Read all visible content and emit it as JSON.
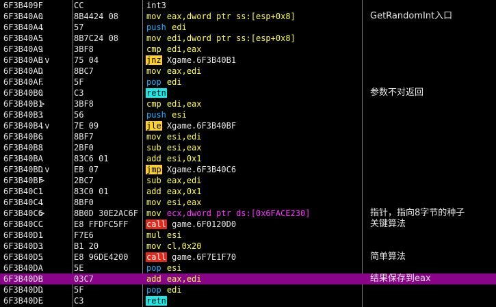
{
  "rows": [
    {
      "addr": "6F3B409F",
      "mark": "",
      "hex": "CC",
      "mn": "int3",
      "mk": "white",
      "ops": "",
      "ok": "plain",
      "cmt": ""
    },
    {
      "addr": "6F3B40A0",
      "mark": ".",
      "hex": "8B4424 08",
      "mn": "mov",
      "mk": "yellow",
      "ops": "eax,dword ptr ss:[esp+0x8]",
      "ok": "yellow",
      "cmt": "GetRandomInt入口"
    },
    {
      "addr": "6F3B40A4",
      "mark": ".",
      "hex": "57",
      "mn": "push",
      "mk": "blue",
      "ops": "edi",
      "ok": "yellow",
      "cmt": ""
    },
    {
      "addr": "6F3B40A5",
      "mark": ".",
      "hex": "8B7C24 08",
      "mn": "mov",
      "mk": "yellow",
      "ops": "edi,dword ptr ss:[esp+0x8]",
      "ok": "yellow",
      "cmt": ""
    },
    {
      "addr": "6F3B40A9",
      "mark": ".",
      "hex": "3BF8",
      "mn": "cmp",
      "mk": "yellow",
      "ops": "edi,eax",
      "ok": "yellow",
      "cmt": ""
    },
    {
      "addr": "6F3B40AB",
      "mark": ".v",
      "hex": "75 04",
      "mn": "jnz",
      "mk": "orange",
      "ops": "Xgame.6F3B40B1",
      "ok": "plain",
      "cmt": ""
    },
    {
      "addr": "6F3B40AD",
      "mark": ".",
      "hex": "8BC7",
      "mn": "mov",
      "mk": "yellow",
      "ops": "eax,edi",
      "ok": "yellow",
      "cmt": ""
    },
    {
      "addr": "6F3B40AF",
      "mark": ".",
      "hex": "5F",
      "mn": "pop",
      "mk": "blue",
      "ops": "edi",
      "ok": "yellow",
      "cmt": ""
    },
    {
      "addr": "6F3B40B0",
      "mark": ".",
      "hex": "C3",
      "mn": "retn",
      "mk": "green",
      "ops": "",
      "ok": "plain",
      "cmt": "参数不对返回"
    },
    {
      "addr": "6F3B40B1",
      "mark": ">",
      "hex": "3BF8",
      "mn": "cmp",
      "mk": "yellow",
      "ops": "edi,eax",
      "ok": "yellow",
      "cmt": ""
    },
    {
      "addr": "6F3B40B3",
      "mark": ".",
      "hex": "56",
      "mn": "push",
      "mk": "blue",
      "ops": "esi",
      "ok": "yellow",
      "cmt": ""
    },
    {
      "addr": "6F3B40B4",
      "mark": ".v",
      "hex": "7E 09",
      "mn": "jle",
      "mk": "orange",
      "ops": "Xgame.6F3B40BF",
      "ok": "plain",
      "cmt": ""
    },
    {
      "addr": "6F3B40B6",
      "mark": ".",
      "hex": "8BF7",
      "mn": "mov",
      "mk": "yellow",
      "ops": "esi,edi",
      "ok": "yellow",
      "cmt": ""
    },
    {
      "addr": "6F3B40B8",
      "mark": ".",
      "hex": "2BF0",
      "mn": "sub",
      "mk": "yellow",
      "ops": "esi,eax",
      "ok": "yellow",
      "cmt": ""
    },
    {
      "addr": "6F3B40BA",
      "mark": ".",
      "hex": "83C6 01",
      "mn": "add",
      "mk": "yellow",
      "ops": "esi,0x1",
      "ok": "yellow",
      "cmt": ""
    },
    {
      "addr": "6F3B40BD",
      "mark": ".v",
      "hex": "EB 07",
      "mn": "jmp",
      "mk": "orange",
      "ops": "Xgame.6F3B40C6",
      "ok": "plain",
      "cmt": ""
    },
    {
      "addr": "6F3B40BF",
      "mark": ">",
      "hex": "2BC7",
      "mn": "sub",
      "mk": "yellow",
      "ops": "eax,edi",
      "ok": "yellow",
      "cmt": ""
    },
    {
      "addr": "6F3B40C1",
      "mark": ".",
      "hex": "83C0 01",
      "mn": "add",
      "mk": "yellow",
      "ops": "eax,0x1",
      "ok": "yellow",
      "cmt": ""
    },
    {
      "addr": "6F3B40C4",
      "mark": ".",
      "hex": "8BF0",
      "mn": "mov",
      "mk": "yellow",
      "ops": "esi,eax",
      "ok": "yellow",
      "cmt": ""
    },
    {
      "addr": "6F3B40C6",
      "mark": ">",
      "hex": "8B0D 30E2AC6F",
      "mn": "mov",
      "mk": "yellow",
      "ops": "ecx,dword ptr ds:[0x6FACE230]",
      "ok": "magenta",
      "cmt": "指针，指向8字节的种子"
    },
    {
      "addr": "6F3B40CC",
      "mark": ".",
      "hex": "E8 FFDFC5FF",
      "mn": "call",
      "mk": "red",
      "ops": "game.6F0120D0",
      "ok": "plain",
      "cmt": "关键算法"
    },
    {
      "addr": "6F3B40D1",
      "mark": ".",
      "hex": "F7E6",
      "mn": "mul",
      "mk": "yellow",
      "ops": "esi",
      "ok": "yellow",
      "cmt": ""
    },
    {
      "addr": "6F3B40D3",
      "mark": ".",
      "hex": "B1 20",
      "mn": "mov",
      "mk": "yellow",
      "ops": "cl,0x20",
      "ok": "yellow",
      "cmt": ""
    },
    {
      "addr": "6F3B40D5",
      "mark": ".",
      "hex": "E8 96DE4200",
      "mn": "call",
      "mk": "red",
      "ops": "game.6F7E1F70",
      "ok": "plain",
      "cmt": "简单算法"
    },
    {
      "addr": "6F3B40DA",
      "mark": ".",
      "hex": "5E",
      "mn": "pop",
      "mk": "blue",
      "ops": "esi",
      "ok": "yellow",
      "cmt": ""
    },
    {
      "addr": "6F3B40DB",
      "mark": ".",
      "hex": "03C7",
      "mn": "add",
      "mk": "yellow",
      "ops": "eax,edi",
      "ok": "yellow",
      "cmt": "结果保存到eax",
      "hl": true
    },
    {
      "addr": "6F3B40DD",
      "mark": ".",
      "hex": "5F",
      "mn": "pop",
      "mk": "blue",
      "ops": "edi",
      "ok": "yellow",
      "cmt": ""
    },
    {
      "addr": "6F3B40DE",
      "mark": ".",
      "hex": "C3",
      "mn": "retn",
      "mk": "green",
      "ops": "",
      "ok": "plain",
      "cmt": ""
    }
  ],
  "colors": {
    "background": "#000000",
    "highlight": "#8a048a",
    "separator": "#7c7c7c"
  }
}
